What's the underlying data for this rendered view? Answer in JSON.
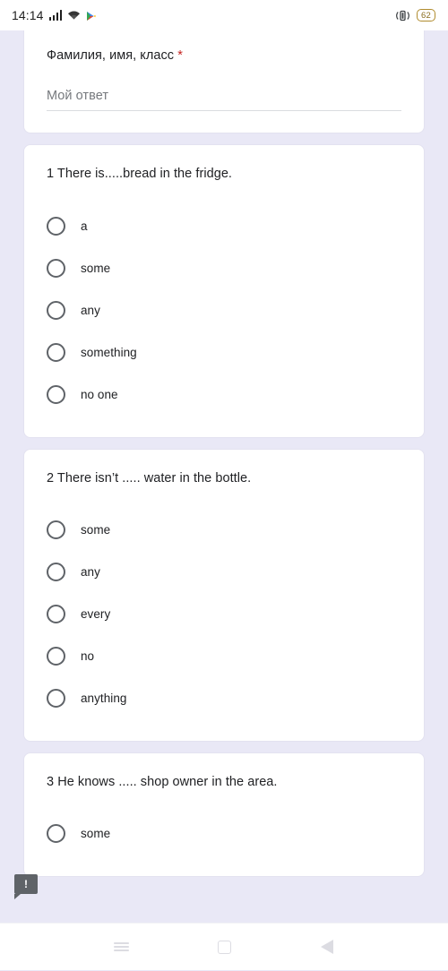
{
  "status_bar": {
    "time": "14:14",
    "battery_level": "62",
    "icons": [
      "signal-icon",
      "wifi-icon",
      "play-store-icon",
      "vibrate-icon",
      "battery-icon"
    ]
  },
  "form": {
    "cards": [
      {
        "type": "short-answer",
        "title": "Фамилия, имя, класс",
        "required_marker": "*",
        "answer_placeholder": "Мой ответ"
      },
      {
        "type": "multiple-choice",
        "title": "1 There is.....bread in the fridge.",
        "options": [
          "a",
          "some",
          "any",
          "something",
          "no one"
        ]
      },
      {
        "type": "multiple-choice",
        "title": "2 There isn’t ..... water in the bottle.",
        "options": [
          "some",
          "any",
          "every",
          "no",
          "anything"
        ]
      },
      {
        "type": "multiple-choice",
        "title": "3 He knows ..... shop owner in the area.",
        "options": [
          "some"
        ]
      }
    ]
  },
  "feedback_badge": {
    "symbol": "!"
  },
  "nav_bar": {
    "buttons": [
      "recents-icon",
      "home-icon",
      "back-icon"
    ]
  },
  "colors": {
    "page_background": "#e9e8f6",
    "card_background": "#ffffff",
    "text_primary": "#202124",
    "text_secondary": "#76797d",
    "required_asterisk": "#c5221f",
    "radio_border": "#5f6368",
    "nav_icon": "#dcdce2"
  }
}
